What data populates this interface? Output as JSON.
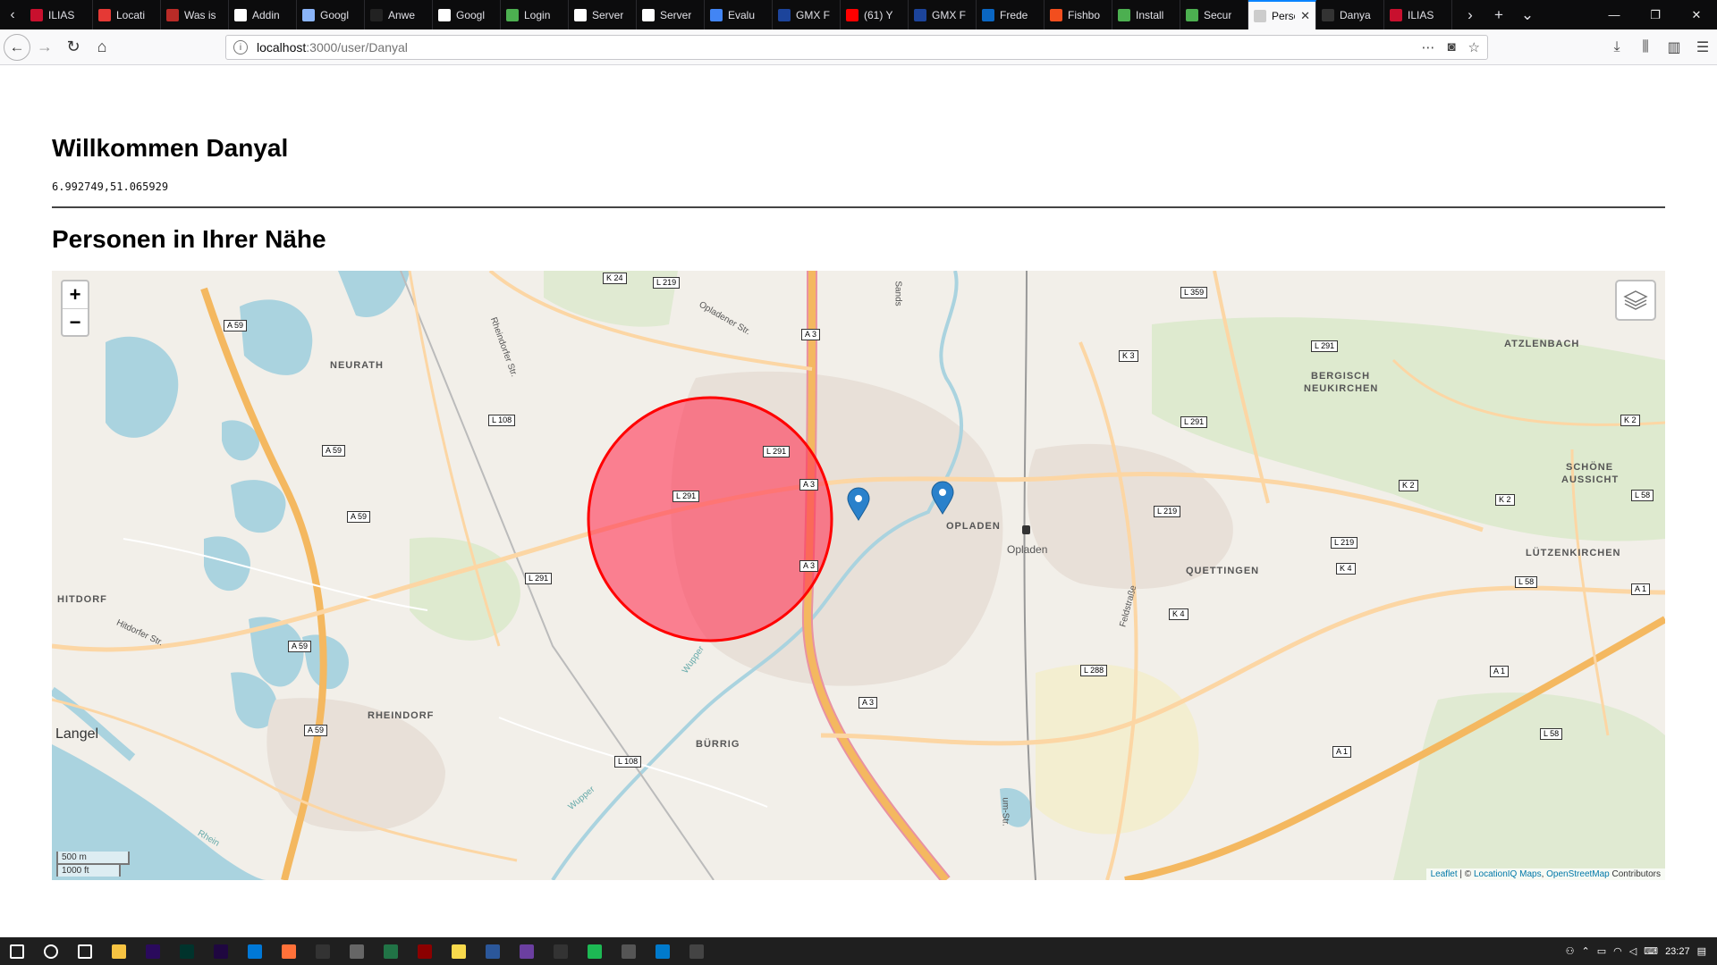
{
  "browser": {
    "tabs": [
      {
        "title": "ILIAS",
        "icon": "ilias-icon",
        "color": "#c8102e"
      },
      {
        "title": "Locati",
        "icon": "locationiq-icon",
        "color": "#e53935"
      },
      {
        "title": "Was is",
        "icon": "quora-icon",
        "color": "#b92b27"
      },
      {
        "title": "Addin",
        "icon": "docs-icon",
        "color": "#ffffff"
      },
      {
        "title": "Googl",
        "icon": "google-icon",
        "color": "#8ab4f8"
      },
      {
        "title": "Anwe",
        "icon": "stack-icon",
        "color": "#222222"
      },
      {
        "title": "Googl",
        "icon": "docs-icon",
        "color": "#ffffff"
      },
      {
        "title": "Login",
        "icon": "mongodb-icon",
        "color": "#4caf50"
      },
      {
        "title": "Server",
        "icon": "warning-icon",
        "color": "#ffffff"
      },
      {
        "title": "Server",
        "icon": "warning-icon",
        "color": "#ffffff"
      },
      {
        "title": "Evalu",
        "icon": "chrome-icon",
        "color": "#4285f4"
      },
      {
        "title": "GMX F",
        "icon": "gmx-icon",
        "color": "#1c449b"
      },
      {
        "title": "(61) Y",
        "icon": "youtube-icon",
        "color": "#ff0000"
      },
      {
        "title": "GMX F",
        "icon": "gmx-icon",
        "color": "#1c449b"
      },
      {
        "title": "Frede",
        "icon": "linkedin-icon",
        "color": "#0a66c2"
      },
      {
        "title": "Fishbo",
        "icon": "figma-icon",
        "color": "#f24e1e"
      },
      {
        "title": "Install",
        "icon": "mongodb-icon",
        "color": "#4caf50"
      },
      {
        "title": "Secur",
        "icon": "mongodb-icon",
        "color": "#4caf50"
      },
      {
        "title": "Person",
        "icon": "page-icon",
        "color": "#cccccc",
        "active": true
      },
      {
        "title": "Danya",
        "icon": "github-icon",
        "color": "#333333"
      },
      {
        "title": "ILIAS",
        "icon": "ilias-icon",
        "color": "#c8102e"
      }
    ],
    "url": {
      "host": "localhost",
      "path": ":3000/user/Danyal"
    }
  },
  "page": {
    "welcome": "Willkommen Danyal",
    "coordinates": "6.992749,51.065929",
    "nearby_heading": "Personen in Ihrer Nähe"
  },
  "map": {
    "zoom_in": "+",
    "zoom_out": "−",
    "scale_metric": "500 m",
    "scale_imperial": "1000 ft",
    "attribution": {
      "leaflet": "Leaflet",
      "sep": " | © ",
      "liq": "LocationIQ Maps",
      "comma": ", ",
      "osm": "OpenStreetMap",
      "contrib": " Contributors"
    },
    "places": {
      "neurath": "NEURATH",
      "bergisch": "BERGISCH",
      "neukirchen": "NEUKIRCHEN",
      "atzlenbach": "ATZLENBACH",
      "schone": "SCHÖNE",
      "aussicht": "AUSSICHT",
      "opladen": "OPLADEN",
      "opladen_station": "Opladen",
      "quettingen": "QUETTINGEN",
      "lutzenkirchen": "LÜTZENKIRCHEN",
      "hitdorf": "HITDORF",
      "rheindorf": "RHEINDORF",
      "burrig": "BÜRRIG",
      "langel": "Langel"
    },
    "roads": {
      "k24": "K 24",
      "l219a": "L 219",
      "a59a": "A 59",
      "a3a": "A 3",
      "l359": "L 359",
      "k3": "K 3",
      "l291a": "L 291",
      "l108a": "L 108",
      "a59b": "A 59",
      "l291b": "L 291",
      "a3b": "A 3",
      "l291c": "L 291",
      "a59c": "A 59",
      "l291d": "L 291",
      "l219b": "L 219",
      "l219c": "L 219",
      "k4a": "K 4",
      "k4b": "K 4",
      "k2a": "K 2",
      "k2b": "K 2",
      "k2c": "K 2",
      "l58a": "L 58",
      "l58b": "L 58",
      "l58c": "L 58",
      "a1a": "A 1",
      "a1b": "A 1",
      "a1c": "A 1",
      "l288": "L 288",
      "a59d": "A 59",
      "a3c": "A 3",
      "a3d": "A 3",
      "l108b": "L 108",
      "l291e": "L 291",
      "a59e": "A 59"
    },
    "streets": {
      "sands": "Sands",
      "opladener": "Opladener Str.",
      "rheindorfer": "Rheindorfer Str.",
      "hitdorfer": "Hitdorfer Str.",
      "wupper1": "Wupper",
      "wupper2": "Wupper",
      "feldstrasse": "Feldstraße",
      "rhein": "Rhein",
      "um": "um-Str."
    },
    "radius_circle": {
      "fill": "#ff3355",
      "stroke": "#ff0000",
      "fill_opacity": 0.6
    },
    "markers": [
      {
        "name": "marker-1",
        "color": "#2a81cb"
      },
      {
        "name": "marker-2",
        "color": "#2a81cb"
      }
    ]
  },
  "taskbar": {
    "apps": [
      {
        "icon": "windows-start-icon",
        "color": "#ffffff"
      },
      {
        "icon": "cortana-search-icon",
        "color": "#ffffff"
      },
      {
        "icon": "task-view-icon",
        "color": "#ffffff"
      },
      {
        "icon": "file-explorer-icon",
        "color": "#f6c342"
      },
      {
        "icon": "premiere-icon",
        "color": "#2a0a5c"
      },
      {
        "icon": "audition-icon",
        "color": "#00332c"
      },
      {
        "icon": "after-effects-icon",
        "color": "#1f0740"
      },
      {
        "icon": "edge-icon",
        "color": "#0078d7"
      },
      {
        "icon": "firefox-icon",
        "color": "#ff7139"
      },
      {
        "icon": "epic-icon",
        "color": "#333333"
      },
      {
        "icon": "app-icon",
        "color": "#666666"
      },
      {
        "icon": "excel-icon",
        "color": "#217346"
      },
      {
        "icon": "app-icon-red",
        "color": "#8b0000"
      },
      {
        "icon": "sticky-notes-icon",
        "color": "#f7d94c"
      },
      {
        "icon": "word-icon",
        "color": "#2b579a"
      },
      {
        "icon": "app-icon-purple",
        "color": "#6b3fa0"
      },
      {
        "icon": "epic-games-icon",
        "color": "#333333"
      },
      {
        "icon": "spotify-icon",
        "color": "#1db954"
      },
      {
        "icon": "app-icon-gray",
        "color": "#555555"
      },
      {
        "icon": "vscode-icon",
        "color": "#007acc"
      },
      {
        "icon": "terminal-icon",
        "color": "#444444"
      }
    ],
    "clock": "23:27"
  }
}
